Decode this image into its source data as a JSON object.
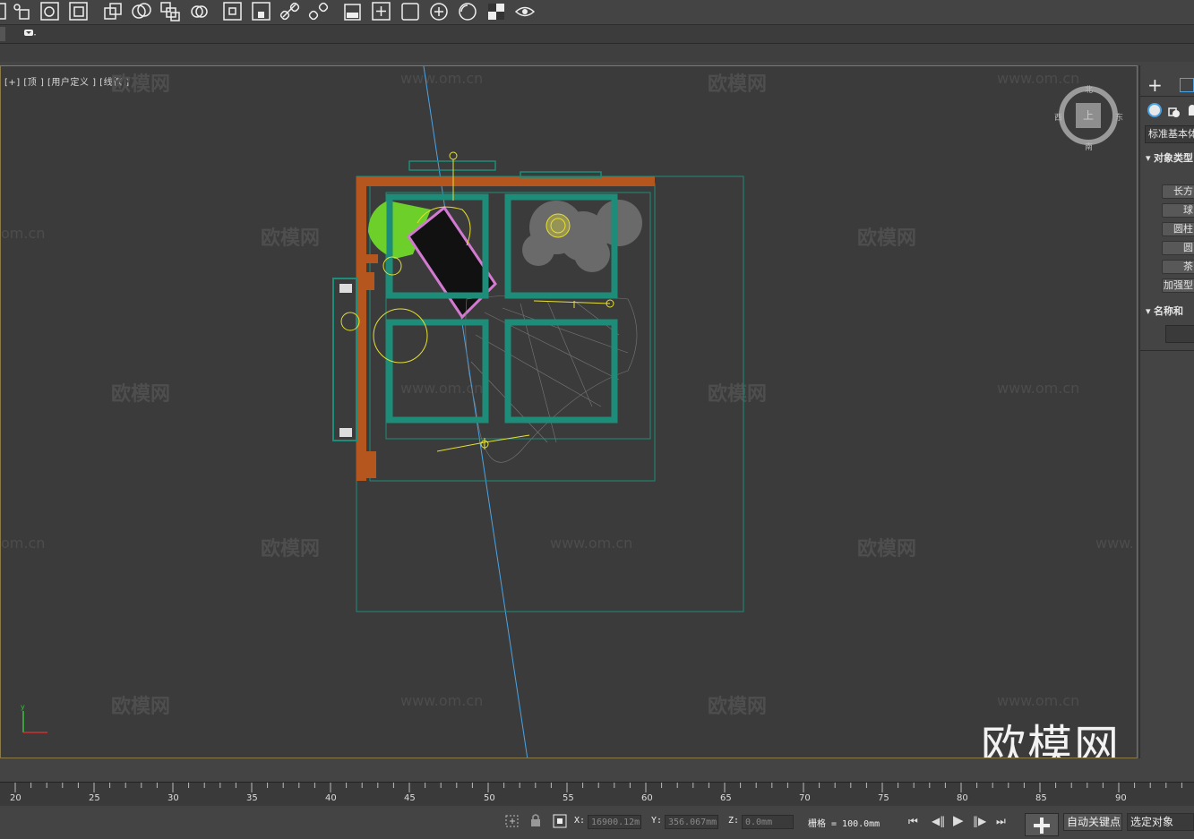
{
  "toolbar": {
    "icons": [
      "select-region-icon",
      "select-name-icon",
      "rect-region-icon",
      "window-crossing-icon",
      "mirror-icon",
      "align-icon",
      "array-icon",
      "snap-toggle-icon",
      "place-icon",
      "keyboard-shortcut-icon",
      "link-icon",
      "unlink-icon",
      "material-editor-icon",
      "add-icon",
      "frame-icon",
      "circle-plus-icon",
      "circle-icon",
      "checker-icon",
      "eye-icon"
    ]
  },
  "viewport": {
    "label": "[+] [顶 ] [用户定义 ] [线框 ]",
    "watermark_text": "欧模网",
    "watermark_url": "www.om.cn",
    "watermark_url_partial": "om.cn",
    "watermark_url_edge": "www.",
    "big_logo": "欧模网",
    "viewcube": {
      "top": "上",
      "north": "北",
      "south": "南",
      "west": "西",
      "east": "东"
    }
  },
  "command_panel": {
    "dropdown": "标准基本体",
    "section_object_type": "对象类型",
    "buttons": [
      "长方",
      "球",
      "圆柱",
      "圆",
      "茶",
      "加强型"
    ],
    "section_name_color": "名称和"
  },
  "timeline": {
    "ticks": [
      "20",
      "25",
      "30",
      "35",
      "40",
      "45",
      "50",
      "55",
      "60",
      "65",
      "70",
      "75",
      "80",
      "85",
      "90"
    ]
  },
  "status": {
    "x_label": "X:",
    "x_value": "16900.12m",
    "y_label": "Y:",
    "y_value": "356.067mm",
    "z_label": "Z:",
    "z_value": "0.0mm",
    "grid_label": "栅格 = 100.0mm",
    "auto_key": "自动关键点",
    "selected_object": "选定对象"
  },
  "colors": {
    "viewport_bg": "#3b3b3b",
    "wall_orange": "#b5561e",
    "frame_teal": "#1d8c78",
    "line_blue": "#4aa3e6",
    "yellow": "#e6e030",
    "green_fill": "#6ccf2a",
    "pink": "#d37ad0"
  }
}
